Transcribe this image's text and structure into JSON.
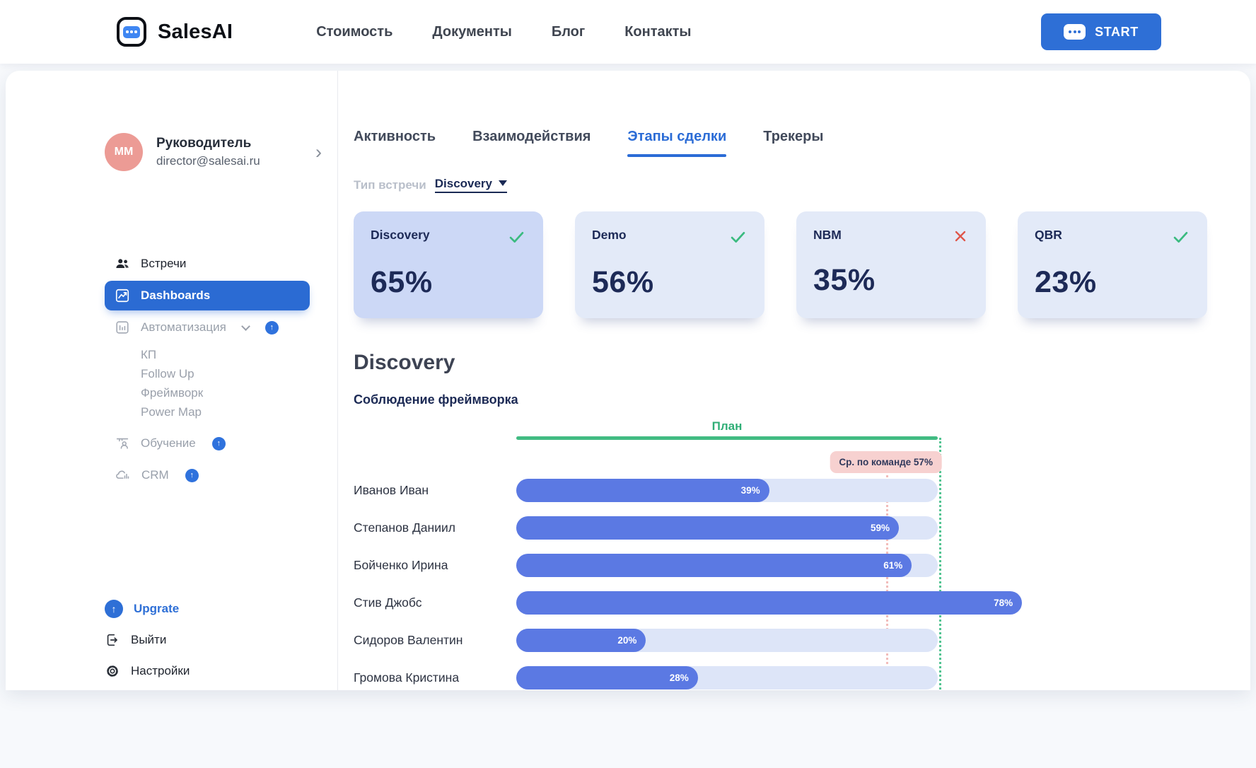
{
  "header": {
    "brand": "SalesAI",
    "nav": [
      {
        "label": "Стоимость"
      },
      {
        "label": "Документы"
      },
      {
        "label": "Блог"
      },
      {
        "label": "Контакты"
      }
    ],
    "start_button": {
      "label": "START",
      "icon": "chat-dots-icon"
    }
  },
  "sidebar": {
    "profile": {
      "initials": "MM",
      "name": "Руководитель",
      "email": "director@salesai.ru"
    },
    "menu": {
      "meetings": {
        "label": "Встречи",
        "icon": "users-icon"
      },
      "dashboards": {
        "label": "Dashboards",
        "icon": "chart-line-icon",
        "active": true
      },
      "automation": {
        "label": "Автоматизация",
        "icon": "chart-bars-icon",
        "badge": "pro-up-arrow"
      },
      "automation_children": [
        {
          "label": "КП"
        },
        {
          "label": "Follow Up"
        },
        {
          "label": "Фреймворк"
        },
        {
          "label": "Power Map"
        }
      ],
      "training": {
        "label": "Обучение",
        "icon": "training-board-icon",
        "badge": "pro-up-arrow"
      },
      "crm": {
        "label": "CRM",
        "icon": "cloud-chart-icon",
        "badge": "pro-up-arrow"
      }
    },
    "footer": {
      "upgrade": {
        "label": "Upgrate",
        "icon": "up-arrow-circle-icon"
      },
      "logout": {
        "label": "Выйти",
        "icon": "logout-icon"
      },
      "settings": {
        "label": "Настройки",
        "icon": "gear-icon"
      }
    }
  },
  "main": {
    "tabs": [
      {
        "label": "Активность",
        "active": false
      },
      {
        "label": "Взаимодействия",
        "active": false
      },
      {
        "label": "Этапы сделки",
        "active": true
      },
      {
        "label": "Трекеры",
        "active": false
      }
    ],
    "filter": {
      "label": "Тип встречи",
      "value": "Discovery"
    },
    "cards": [
      {
        "title": "Discovery",
        "value": "65%",
        "status": "check",
        "selected": true
      },
      {
        "title": "Demo",
        "value": "56%",
        "status": "check",
        "selected": false
      },
      {
        "title": "NBM",
        "value": "35%",
        "status": "cross",
        "selected": false
      },
      {
        "title": "QBR",
        "value": "23%",
        "status": "check",
        "selected": false
      }
    ],
    "section_title": "Discovery",
    "chart_heading": "Соблюдение фреймворка"
  },
  "chart_data": {
    "type": "bar",
    "orientation": "horizontal",
    "categories": [
      "Иванов Иван",
      "Степанов Даниил",
      "Бойченко Ирина",
      "Стив Джобс",
      "Сидоров Валентин",
      "Громова Кристина"
    ],
    "values": [
      39,
      59,
      61,
      78,
      20,
      28
    ],
    "value_suffix": "%",
    "xlim": [
      0,
      65
    ],
    "plan": {
      "label": "План",
      "value": 65
    },
    "team_avg": {
      "label": "Ср. по команде 57%",
      "value": 57
    },
    "grid": false,
    "colors": {
      "bar": "#5b79e3",
      "track": "#dde5f8",
      "plan_line": "#41bb82",
      "avg_line": "#f2bcba",
      "avg_badge_bg": "#f7d1d0"
    }
  },
  "colors": {
    "accent_blue": "#2e6fd6",
    "navy": "#1d2a57",
    "green_check": "#3bbb80",
    "red_cross": "#df5549",
    "avatar_bg": "#ec9b95"
  }
}
